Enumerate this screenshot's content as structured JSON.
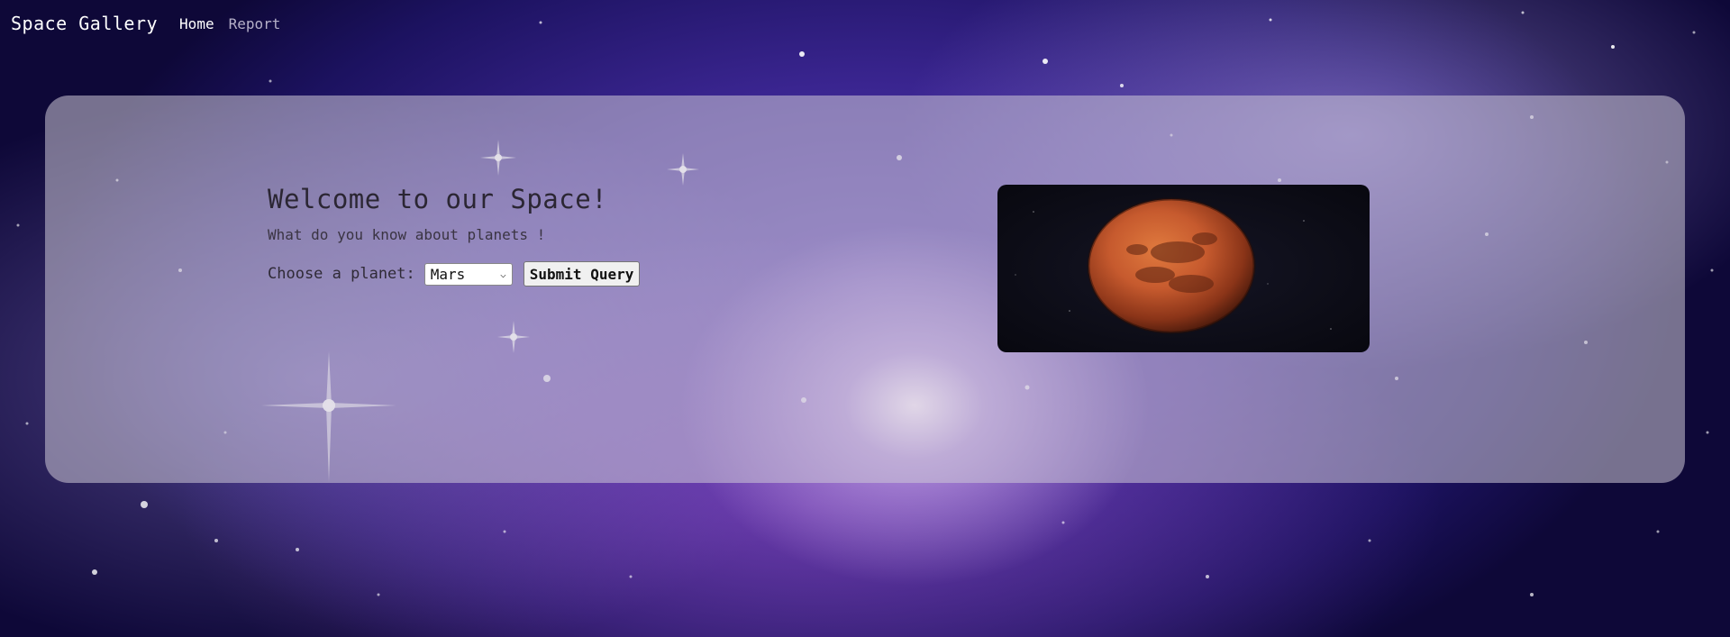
{
  "navbar": {
    "brand": "Space Gallery",
    "links": [
      {
        "label": "Home"
      },
      {
        "label": "Report"
      }
    ]
  },
  "main": {
    "title": "Welcome to our Space!",
    "subtitle": "What do you know about planets !",
    "form": {
      "label": "Choose a planet:",
      "selected_planet": "Mars",
      "submit_label": "Submit Query"
    },
    "image": {
      "subject": "planet-mars",
      "accent_color": "#c65a2e"
    }
  }
}
